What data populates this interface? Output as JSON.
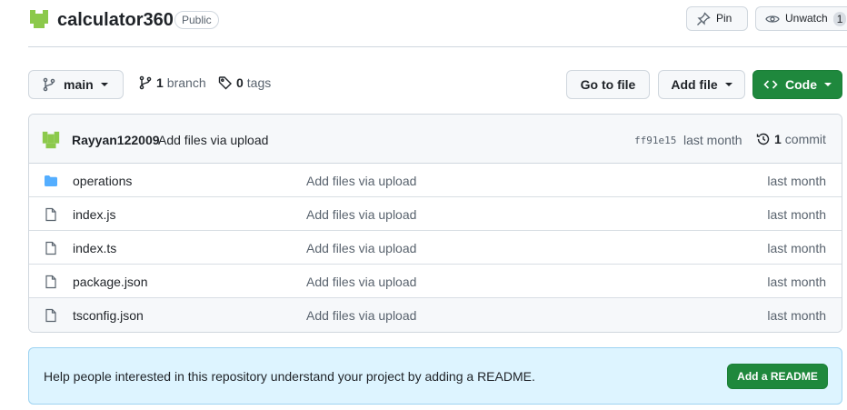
{
  "repo": {
    "name": "calculator360",
    "visibility": "Public",
    "avatar_icon": "identicon-avatar",
    "avatar_color": "#8cc94b"
  },
  "actions": {
    "pin_label": "Pin",
    "unwatch_label": "Unwatch",
    "watch_count": "1"
  },
  "toolbar": {
    "branch": "main",
    "branch_count": "1",
    "branch_label": "branch",
    "tag_count": "0",
    "tag_label": "tags",
    "goto_file": "Go to file",
    "add_file": "Add file",
    "code": "Code"
  },
  "commit": {
    "author": "Rayyan122009",
    "message": "Add files via upload",
    "sha": "ff91e15",
    "time": "last month",
    "count": "1",
    "count_label": "commit"
  },
  "files": [
    {
      "name": "operations",
      "type": "folder",
      "message": "Add files via upload",
      "time": "last month"
    },
    {
      "name": "index.js",
      "type": "file",
      "message": "Add files via upload",
      "time": "last month"
    },
    {
      "name": "index.ts",
      "type": "file",
      "message": "Add files via upload",
      "time": "last month"
    },
    {
      "name": "package.json",
      "type": "file",
      "message": "Add files via upload",
      "time": "last month"
    },
    {
      "name": "tsconfig.json",
      "type": "file",
      "message": "Add files via upload",
      "time": "last month"
    }
  ],
  "readme_banner": {
    "text": "Help people interested in this repository understand your project by adding a README.",
    "button": "Add a README"
  },
  "colors": {
    "accent_green": "#1f883d",
    "folder_blue": "#54aeff",
    "banner_bg": "#ddf4ff"
  }
}
